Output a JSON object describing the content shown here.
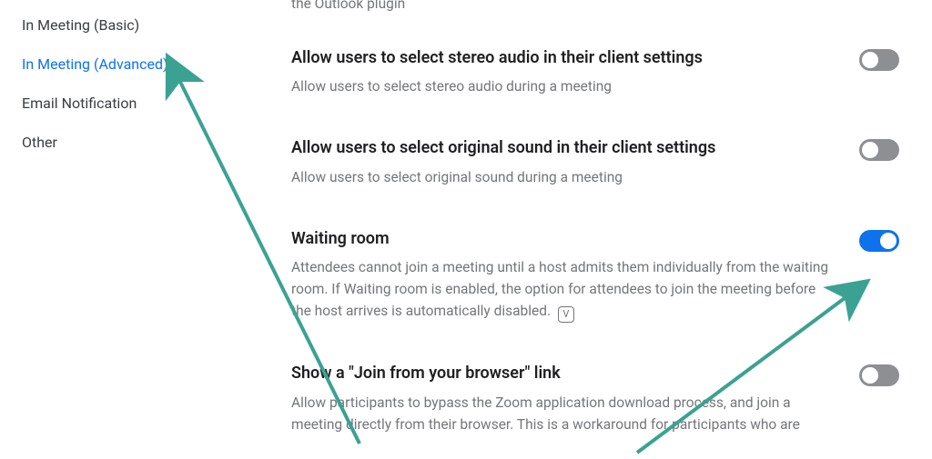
{
  "sidebar": {
    "items": [
      {
        "label": "In Meeting (Basic)",
        "active": false
      },
      {
        "label": "In Meeting (Advanced)",
        "active": true
      },
      {
        "label": "Email Notification",
        "active": false
      },
      {
        "label": "Other",
        "active": false
      }
    ]
  },
  "settings": {
    "fragment_desc": "the Outlook plugin",
    "stereo": {
      "title": "Allow users to select stereo audio in their client settings",
      "desc": "Allow users to select stereo audio during a meeting",
      "on": false
    },
    "original_sound": {
      "title": "Allow users to select original sound in their client settings",
      "desc": "Allow users to select original sound during a meeting",
      "on": false
    },
    "waiting_room": {
      "title": "Waiting room",
      "desc": "Attendees cannot join a meeting until a host admits them individually from the waiting room. If Waiting room is enabled, the option for attendees to join the meeting before the host arrives is automatically disabled.",
      "badge": "V",
      "on": true
    },
    "join_browser": {
      "title": "Show a \"Join from your browser\" link",
      "desc": "Allow participants to bypass the Zoom application download process, and join a meeting directly from their browser. This is a workaround for participants who are",
      "on": false
    }
  },
  "colors": {
    "accent": "#0E72ED",
    "arrow": "#3BA293"
  }
}
